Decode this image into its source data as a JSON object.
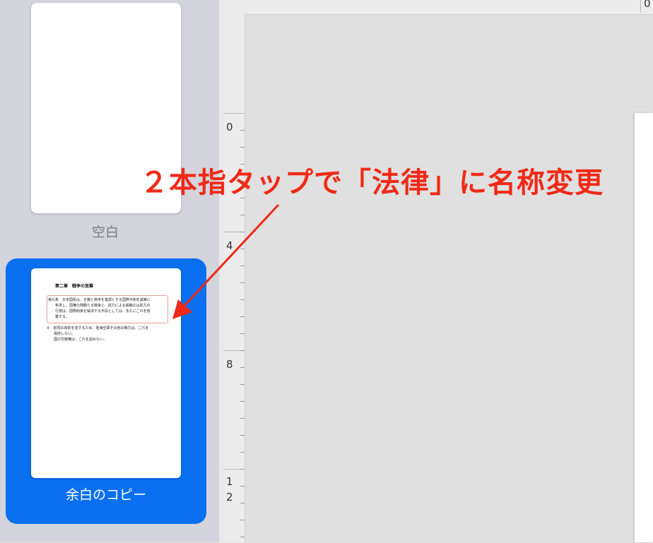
{
  "sidebar": {
    "slides": [
      {
        "label": "空白",
        "selected": false
      },
      {
        "label": "余白のコピー",
        "selected": true
      }
    ],
    "selected_color": "#0a6ff0"
  },
  "thumbnail_document": {
    "title": "第二章　戦争の放棄",
    "box_lines": [
      "第九条　日本国民は、正義と秩序を基調とする国際平和を誠実に",
      "　　希求し、国権の発動たる戦争と、武力による威嚇又は武力の",
      "　　行使は、国際紛争を解決する手段としては、永久にこれを放",
      "　　棄する。"
    ],
    "lines": [
      "②　前項の目的を達するため、陸海空軍その他の戦力は、これを",
      "　　保持しない。",
      "　　国の交戦権は、これを認めない。"
    ]
  },
  "ruler": {
    "top_label": "0",
    "left_labels": [
      "0",
      "4",
      "8",
      "1",
      "2"
    ]
  },
  "annotation": {
    "text": "２本指タップで「法律」に名称変更",
    "color": "#f02a17"
  }
}
